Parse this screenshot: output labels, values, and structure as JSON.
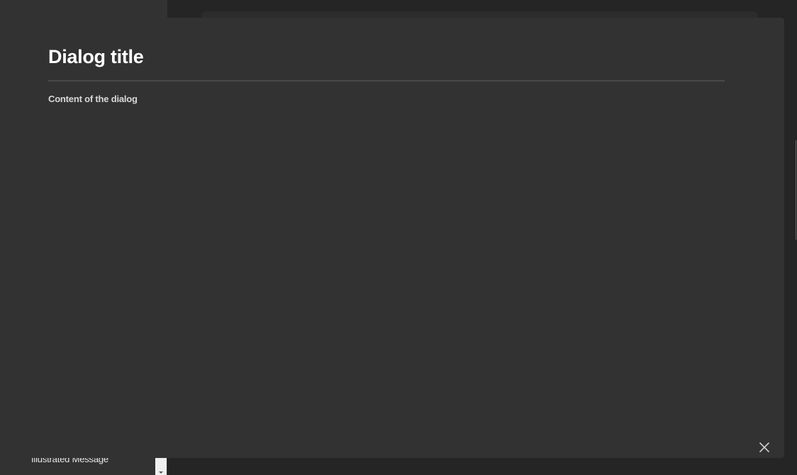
{
  "sidebar": {
    "bottom_item": "Illustrated Message"
  },
  "dialog": {
    "title": "Dialog title",
    "content": "Content of the dialog",
    "close_icon": "close-icon"
  },
  "colors": {
    "background": "#252525",
    "sidebar": "#323232",
    "dialog": "#323232",
    "brand": "#e61c1c",
    "title_text": "#ffffff",
    "divider": "#4a4a4a"
  }
}
